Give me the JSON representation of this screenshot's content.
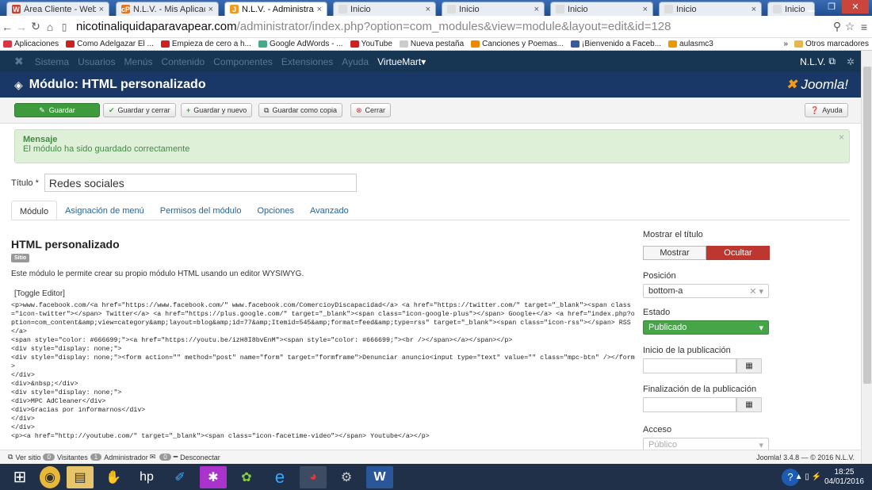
{
  "browser": {
    "tabs": [
      {
        "label": "Área Cliente - Webem",
        "icon": "W",
        "color": "#c8412f"
      },
      {
        "label": "N.L.V. - Mis Aplicacion",
        "icon": "cP",
        "color": "#e8751a"
      },
      {
        "label": "N.L.V. - Administracio",
        "icon": "J",
        "color": "#f29a1e"
      },
      {
        "label": "Inicio",
        "icon": "",
        "color": "#ddd"
      },
      {
        "label": "Inicio",
        "icon": "",
        "color": "#ddd"
      },
      {
        "label": "Inicio",
        "icon": "",
        "color": "#ddd"
      },
      {
        "label": "Inicio",
        "icon": "",
        "color": "#ddd"
      },
      {
        "label": "Inicio",
        "icon": "",
        "color": "#ddd"
      }
    ],
    "url_host": "nicotinaliquidaparavapear.com",
    "url_path": "/administrator/index.php?option=com_modules&view=module&layout=edit&id=128",
    "bookmarks": [
      {
        "label": "Aplicaciones",
        "color": "#d34"
      },
      {
        "label": "Como Adelgazar El ...",
        "color": "#c22"
      },
      {
        "label": "Empieza de cero a h...",
        "color": "#c22"
      },
      {
        "label": "Google AdWords - ...",
        "color": "#4a8"
      },
      {
        "label": "YouTube",
        "color": "#c22"
      },
      {
        "label": "Nueva pestaña",
        "color": "#ccc"
      },
      {
        "label": "Canciones y Poemas...",
        "color": "#e80"
      },
      {
        "label": "¡Bienvenido a Faceb...",
        "color": "#3b5998"
      },
      {
        "label": "aulasmc3",
        "color": "#e90"
      }
    ],
    "other_bookmarks": "Otros marcadores"
  },
  "joomla": {
    "menu": [
      "Sistema",
      "Usuarios",
      "Menús",
      "Contenido",
      "Componentes",
      "Extensiones",
      "Ayuda"
    ],
    "virtuemart": "VirtueMart",
    "user": "N.L.V.",
    "page_title": "Módulo: HTML personalizado",
    "logo": "Joomla!",
    "toolbar": {
      "save": "Guardar",
      "save_close": "Guardar y cerrar",
      "save_new": "Guardar y nuevo",
      "save_copy": "Guardar como copia",
      "close": "Cerrar",
      "help": "Ayuda"
    },
    "message": {
      "heading": "Mensaje",
      "text": "El módulo ha sido guardado correctamente"
    },
    "title_label": "Título *",
    "title_value": "Redes sociales",
    "tabs": [
      "Módulo",
      "Asignación de menú",
      "Permisos del módulo",
      "Opciones",
      "Avanzado"
    ],
    "module_heading": "HTML personalizado",
    "site_badge": "Sitio",
    "description": "Este módulo le permite crear su propio módulo HTML usando un editor WYSIWYG.",
    "toggle_editor": "[Toggle Editor]",
    "code": "<p>www.facebook.com/<a href=\"https://www.facebook.com/\" www.facebook.com/ComercioyDiscapacidad</a> <a href=\"https://twitter.com/\" target=\"_blank\"><span class=\"icon-twitter\"></span> Twitter</a> <a href=\"https://plus.google.com/\" target=\"_blank\"><span class=\"icon-google-plus\"></span> Google+</a> <a href=\"index.php?option=com_content&amp;view=category&amp;layout=blog&amp;id=77&amp;Itemid=545&amp;format=feed&amp;type=rss\" target=\"_blank\"><span class=\"icon-rss\"></span> RSS</a>\n<span style=\"color: #666699;\"><a href=\"https://youtu.be/izH8I8bvEnM\"><span style=\"color: #666699;\"><br /></span></a></span></p>\n<div style=\"display: none;\">\n<div style=\"display: none;\"><form action=\"\" method=\"post\" name=\"form\" target=\"formframe\">Denunciar anuncio<input type=\"text\" value=\"\" class=\"mpc-btn\" /></form>\n</div>\n<div>&nbsp;</div>\n<div style=\"display: none;\">\n<div>MPC AdCleaner</div>\n<div>Gracias por informarnos</div>\n</div>\n</div>\n<p><a href=\"http://youtube.com/\" target=\"_blank\"><span class=\"icon-facetime-video\"></span> Youtube</a></p>",
    "side": {
      "show_title_label": "Mostrar el título",
      "show": "Mostrar",
      "hide": "Ocultar",
      "position_label": "Posición",
      "position_value": "bottom-a",
      "state_label": "Estado",
      "state_value": "Publicado",
      "pub_start_label": "Inicio de la publicación",
      "pub_end_label": "Finalización de la publicación",
      "access_label": "Acceso",
      "access_value": "Público"
    },
    "statusbar": {
      "view_site": "Ver sitio",
      "visitors_count": "0",
      "visitors": "Visitantes",
      "admin_count": "1",
      "admin": "Administrador",
      "msg_count": "0",
      "logout": "Desconectar",
      "version": "Joomla! 3.4.8 — © 2016 N.L.V."
    }
  },
  "taskbar": {
    "time": "18:25",
    "date": "04/01/2016"
  }
}
